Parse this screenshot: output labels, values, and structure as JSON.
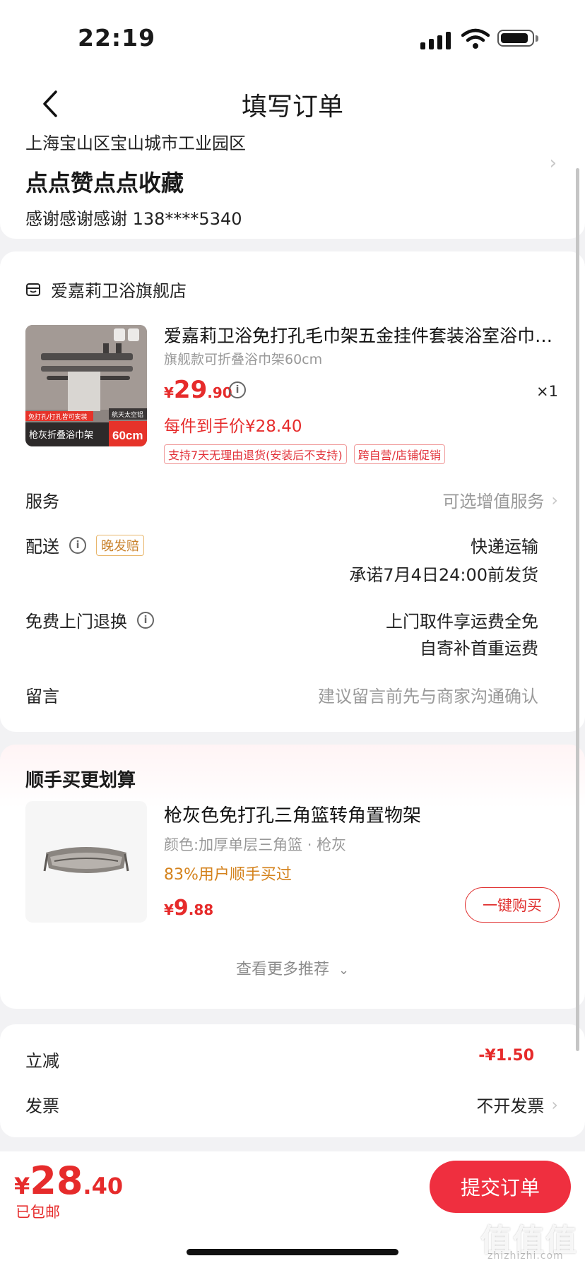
{
  "status_bar": {
    "time": "22:19"
  },
  "header": {
    "title": "填写订单"
  },
  "address": {
    "line": "上海宝山区宝山城市工业园区",
    "name": "点点赞点点收藏",
    "contact": "感谢感谢感谢  138****5340"
  },
  "store": {
    "name": "爱嘉莉卫浴旗舰店",
    "product": {
      "title": "爱嘉莉卫浴免打孔毛巾架五金挂件套装浴室浴巾…",
      "spec": "旗舰款可折叠浴巾架60cm",
      "price_currency": "¥",
      "price_int": "29",
      "price_dec": ".90",
      "qty": "×1",
      "final_price": "每件到手价¥28.40",
      "tags": [
        "支持7天无理由退货(安装后不支持)",
        "跨自营/店铺促销"
      ],
      "thumb_texts": {
        "top": "免打孔/打孔皆可安装",
        "corner": "航天太空铝",
        "bottom": "枪灰折叠浴巾架",
        "size": "60cm"
      }
    },
    "service": {
      "label": "服务",
      "value": "可选增值服务"
    },
    "delivery": {
      "label": "配送",
      "badge": "晚发赔",
      "line1": "快递运输",
      "line2": "承诺7月4日24:00前发货"
    },
    "return": {
      "label": "免费上门退换",
      "line1": "上门取件享运费全免",
      "line2": "自寄补首重运费"
    },
    "message": {
      "label": "留言",
      "placeholder": "建议留言前先与商家沟通确认"
    }
  },
  "recommend": {
    "title": "顺手买更划算",
    "item": {
      "name": "枪灰色免打孔三角篮转角置物架",
      "spec": "颜色:加厚单层三角篮 · 枪灰",
      "stat": "83%用户顺手买过",
      "price_currency": "¥",
      "price_int": "9",
      "price_dec": ".88",
      "buy_label": "一键购买"
    },
    "more_label": "查看更多推荐"
  },
  "summary": {
    "discount_label": "立减",
    "discount_value": "-¥1.50",
    "invoice_label": "发票",
    "invoice_value": "不开发票"
  },
  "bottom_bar": {
    "total_currency": "¥",
    "total_int": "28",
    "total_dec": ".40",
    "shipping": "已包邮",
    "submit_label": "提交订单"
  },
  "watermark": {
    "text": "值值值",
    "sub": "zhizhizhi.com"
  },
  "colors": {
    "accent": "#ef2f3f",
    "price": "#e62b2b",
    "badge": "#c9812b",
    "bg": "#f2f2f4"
  }
}
